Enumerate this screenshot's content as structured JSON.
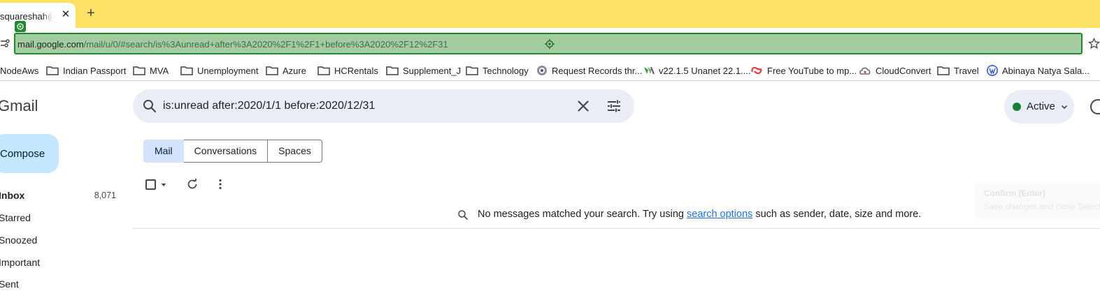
{
  "browser": {
    "tab": {
      "title": "squareshah@gmail.com",
      "close_glyph": "✕"
    },
    "new_tab_glyph": "+",
    "url": {
      "host": "mail.google.com",
      "path": "/mail/u/0/#search/is%3Aunread+after%3A2020%2F1%2F1+before%3A2020%2F12%2F31"
    },
    "chrome_color": "#fde165",
    "omnibox_highlight": "#a3cca1"
  },
  "bookmarks": [
    {
      "label": "NodeAws",
      "icon": "none"
    },
    {
      "label": "Indian Passport",
      "icon": "folder-icon"
    },
    {
      "label": "MVA",
      "icon": "folder-icon"
    },
    {
      "label": "Unemployment",
      "icon": "folder-icon"
    },
    {
      "label": "Azure",
      "icon": "folder-icon"
    },
    {
      "label": "HCRentals",
      "icon": "folder-icon"
    },
    {
      "label": "Supplement_J",
      "icon": "folder-icon"
    },
    {
      "label": "Technology",
      "icon": "folder-icon"
    },
    {
      "label": "Request Records thr...",
      "icon": "seal-icon"
    },
    {
      "label": "v22.1.5 Unanet 22.1....",
      "icon": "unanet-icon"
    },
    {
      "label": "Free YouTube to mp...",
      "icon": "loop-icon"
    },
    {
      "label": "CloudConvert",
      "icon": "cloud-icon"
    },
    {
      "label": "Travel",
      "icon": "folder-icon"
    },
    {
      "label": "Abinaya Natya Sala...",
      "icon": "wordpress-icon"
    }
  ],
  "gmail": {
    "logo_text": "Gmail",
    "search": {
      "query": "is:unread after:2020/1/1 before:2020/12/31"
    },
    "status": {
      "label": "Active",
      "color": "#188038"
    },
    "compose_label": "Compose",
    "nav": [
      {
        "label": "Inbox",
        "count": "8,071"
      },
      {
        "label": "Starred",
        "count": ""
      },
      {
        "label": "Snoozed",
        "count": ""
      },
      {
        "label": "Important",
        "count": ""
      },
      {
        "label": "Sent",
        "count": ""
      }
    ],
    "chips": [
      "Mail",
      "Conversations",
      "Spaces"
    ],
    "empty": {
      "before": "No messages matched your search. Try using ",
      "link": "search options",
      "after": " such as sender, date, size and more."
    },
    "tooltip": {
      "title": "Confirm (Enter)",
      "subtitle": "Save changes and close Selector"
    }
  }
}
